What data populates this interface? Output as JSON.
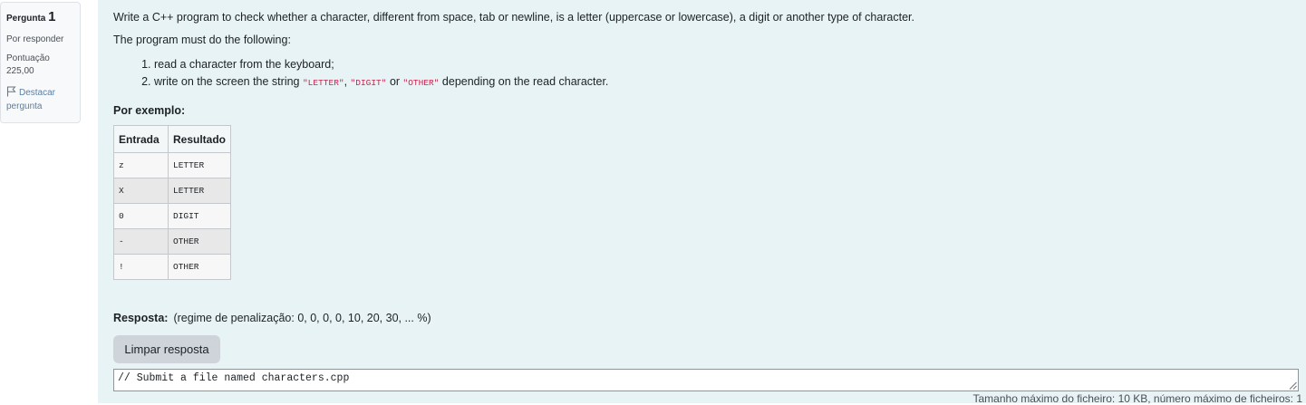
{
  "info": {
    "question_prefix": "Pergunta",
    "question_number": "1",
    "state": "Por responder",
    "grade_label": "Pontuação",
    "grade_value": "225,00",
    "flag_label": "Destacar pergunta"
  },
  "question": {
    "intro": "Write a C++ program to check whether a character, different from space, tab or newline, is a letter (uppercase or lowercase), a digit or another type of character.",
    "must_do": "The program must do the following:",
    "step1": "read a character from the keyboard;",
    "step2_before": "write on the screen the string ",
    "kw_letter": "\"LETTER\"",
    "sep1": ", ",
    "kw_digit": "\"DIGIT\"",
    "sep2": " or ",
    "kw_other": "\"OTHER\"",
    "step2_after": " depending on the read character."
  },
  "example": {
    "title": "Por exemplo:",
    "headers": [
      "Entrada",
      "Resultado"
    ],
    "rows": [
      [
        "z",
        "LETTER"
      ],
      [
        "X",
        "LETTER"
      ],
      [
        "0",
        "DIGIT"
      ],
      [
        "-",
        "OTHER"
      ],
      [
        "!",
        "OTHER"
      ]
    ]
  },
  "answer": {
    "label": "Resposta:",
    "penalty": "(regime de penalização: 0, 0, 0, 0, 10, 20, 30, ... %)",
    "clear_button": "Limpar resposta",
    "value": "// Submit a file named characters.cpp",
    "file_limits": "Tamanho máximo do ficheiro: 10 KB, número máximo de ficheiros: 1"
  },
  "colors": {
    "content_bg": "#e7f3f5",
    "keyword": "#c7254e",
    "flag_link": "#5a7fa3"
  },
  "icons": {
    "flag": "flag-icon",
    "resize": "resize-grip-icon"
  }
}
